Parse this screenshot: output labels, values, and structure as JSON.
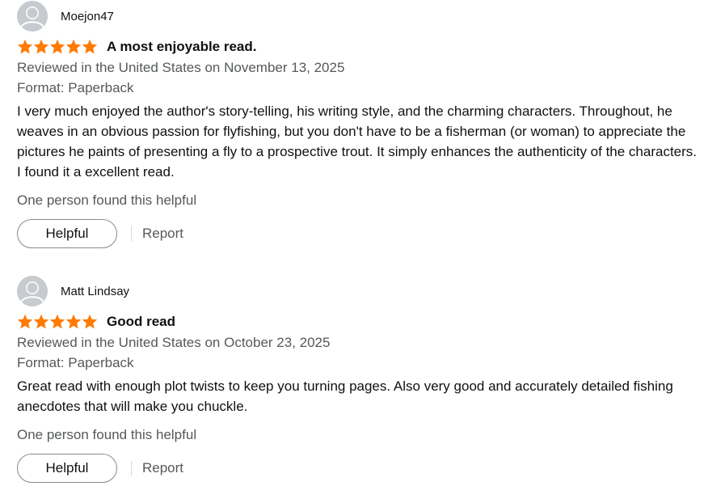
{
  "colors": {
    "star": "#ff7a00",
    "text": "#0f1111",
    "secondary_text": "#565959",
    "avatar_bg": "#c7cbcf",
    "button_border": "#888c8c"
  },
  "reviews": [
    {
      "profile_name": "Moejon47",
      "rating": 5,
      "title": "A most enjoyable read.",
      "date_line": "Reviewed in the United States on November 13, 2025",
      "format": "Format: Paperback",
      "body": "I very much enjoyed the author's story-telling, his writing style, and the charming characters. Throughout, he weaves in an obvious passion for flyfishing, but you don't have to be a fisherman (or woman) to appreciate the pictures he paints of presenting a fly to a prospective trout. It simply enhances the authenticity of the characters. I found it a excellent read.",
      "helpful_count": "One person found this helpful",
      "helpful_label": "Helpful",
      "report_label": "Report"
    },
    {
      "profile_name": "Matt Lindsay",
      "rating": 5,
      "title": "Good read",
      "date_line": "Reviewed in the United States on October 23, 2025",
      "format": "Format: Paperback",
      "body": "Great read with enough plot twists to keep you turning pages. Also very good and accurately detailed fishing anecdotes that will make you chuckle.",
      "helpful_count": "One person found this helpful",
      "helpful_label": "Helpful",
      "report_label": "Report"
    }
  ]
}
